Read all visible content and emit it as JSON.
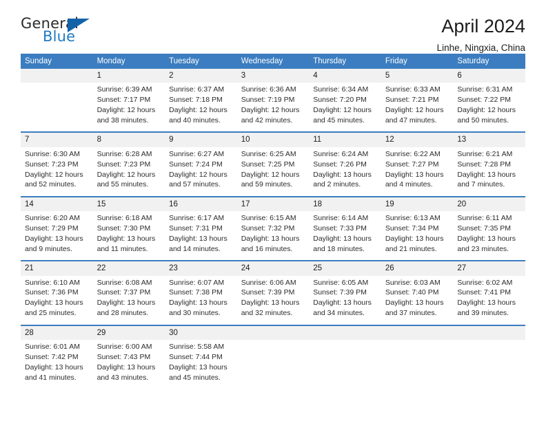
{
  "logo": {
    "word_general": "General",
    "word_blue": "Blue",
    "flag_icon": "blue-triangle-flag-icon"
  },
  "header": {
    "title": "April 2024",
    "location": "Linhe, Ningxia, China"
  },
  "calendar": {
    "columns": [
      "Sunday",
      "Monday",
      "Tuesday",
      "Wednesday",
      "Thursday",
      "Friday",
      "Saturday"
    ],
    "header_bg": "#3b7dc0",
    "daynum_bg": "#f1f1f1",
    "weeks": [
      [
        {
          "day": "",
          "sunrise": "",
          "sunset": "",
          "daylight_1": "",
          "daylight_2": ""
        },
        {
          "day": "1",
          "sunrise": "Sunrise: 6:39 AM",
          "sunset": "Sunset: 7:17 PM",
          "daylight_1": "Daylight: 12 hours",
          "daylight_2": "and 38 minutes."
        },
        {
          "day": "2",
          "sunrise": "Sunrise: 6:37 AM",
          "sunset": "Sunset: 7:18 PM",
          "daylight_1": "Daylight: 12 hours",
          "daylight_2": "and 40 minutes."
        },
        {
          "day": "3",
          "sunrise": "Sunrise: 6:36 AM",
          "sunset": "Sunset: 7:19 PM",
          "daylight_1": "Daylight: 12 hours",
          "daylight_2": "and 42 minutes."
        },
        {
          "day": "4",
          "sunrise": "Sunrise: 6:34 AM",
          "sunset": "Sunset: 7:20 PM",
          "daylight_1": "Daylight: 12 hours",
          "daylight_2": "and 45 minutes."
        },
        {
          "day": "5",
          "sunrise": "Sunrise: 6:33 AM",
          "sunset": "Sunset: 7:21 PM",
          "daylight_1": "Daylight: 12 hours",
          "daylight_2": "and 47 minutes."
        },
        {
          "day": "6",
          "sunrise": "Sunrise: 6:31 AM",
          "sunset": "Sunset: 7:22 PM",
          "daylight_1": "Daylight: 12 hours",
          "daylight_2": "and 50 minutes."
        }
      ],
      [
        {
          "day": "7",
          "sunrise": "Sunrise: 6:30 AM",
          "sunset": "Sunset: 7:23 PM",
          "daylight_1": "Daylight: 12 hours",
          "daylight_2": "and 52 minutes."
        },
        {
          "day": "8",
          "sunrise": "Sunrise: 6:28 AM",
          "sunset": "Sunset: 7:23 PM",
          "daylight_1": "Daylight: 12 hours",
          "daylight_2": "and 55 minutes."
        },
        {
          "day": "9",
          "sunrise": "Sunrise: 6:27 AM",
          "sunset": "Sunset: 7:24 PM",
          "daylight_1": "Daylight: 12 hours",
          "daylight_2": "and 57 minutes."
        },
        {
          "day": "10",
          "sunrise": "Sunrise: 6:25 AM",
          "sunset": "Sunset: 7:25 PM",
          "daylight_1": "Daylight: 12 hours",
          "daylight_2": "and 59 minutes."
        },
        {
          "day": "11",
          "sunrise": "Sunrise: 6:24 AM",
          "sunset": "Sunset: 7:26 PM",
          "daylight_1": "Daylight: 13 hours",
          "daylight_2": "and 2 minutes."
        },
        {
          "day": "12",
          "sunrise": "Sunrise: 6:22 AM",
          "sunset": "Sunset: 7:27 PM",
          "daylight_1": "Daylight: 13 hours",
          "daylight_2": "and 4 minutes."
        },
        {
          "day": "13",
          "sunrise": "Sunrise: 6:21 AM",
          "sunset": "Sunset: 7:28 PM",
          "daylight_1": "Daylight: 13 hours",
          "daylight_2": "and 7 minutes."
        }
      ],
      [
        {
          "day": "14",
          "sunrise": "Sunrise: 6:20 AM",
          "sunset": "Sunset: 7:29 PM",
          "daylight_1": "Daylight: 13 hours",
          "daylight_2": "and 9 minutes."
        },
        {
          "day": "15",
          "sunrise": "Sunrise: 6:18 AM",
          "sunset": "Sunset: 7:30 PM",
          "daylight_1": "Daylight: 13 hours",
          "daylight_2": "and 11 minutes."
        },
        {
          "day": "16",
          "sunrise": "Sunrise: 6:17 AM",
          "sunset": "Sunset: 7:31 PM",
          "daylight_1": "Daylight: 13 hours",
          "daylight_2": "and 14 minutes."
        },
        {
          "day": "17",
          "sunrise": "Sunrise: 6:15 AM",
          "sunset": "Sunset: 7:32 PM",
          "daylight_1": "Daylight: 13 hours",
          "daylight_2": "and 16 minutes."
        },
        {
          "day": "18",
          "sunrise": "Sunrise: 6:14 AM",
          "sunset": "Sunset: 7:33 PM",
          "daylight_1": "Daylight: 13 hours",
          "daylight_2": "and 18 minutes."
        },
        {
          "day": "19",
          "sunrise": "Sunrise: 6:13 AM",
          "sunset": "Sunset: 7:34 PM",
          "daylight_1": "Daylight: 13 hours",
          "daylight_2": "and 21 minutes."
        },
        {
          "day": "20",
          "sunrise": "Sunrise: 6:11 AM",
          "sunset": "Sunset: 7:35 PM",
          "daylight_1": "Daylight: 13 hours",
          "daylight_2": "and 23 minutes."
        }
      ],
      [
        {
          "day": "21",
          "sunrise": "Sunrise: 6:10 AM",
          "sunset": "Sunset: 7:36 PM",
          "daylight_1": "Daylight: 13 hours",
          "daylight_2": "and 25 minutes."
        },
        {
          "day": "22",
          "sunrise": "Sunrise: 6:08 AM",
          "sunset": "Sunset: 7:37 PM",
          "daylight_1": "Daylight: 13 hours",
          "daylight_2": "and 28 minutes."
        },
        {
          "day": "23",
          "sunrise": "Sunrise: 6:07 AM",
          "sunset": "Sunset: 7:38 PM",
          "daylight_1": "Daylight: 13 hours",
          "daylight_2": "and 30 minutes."
        },
        {
          "day": "24",
          "sunrise": "Sunrise: 6:06 AM",
          "sunset": "Sunset: 7:39 PM",
          "daylight_1": "Daylight: 13 hours",
          "daylight_2": "and 32 minutes."
        },
        {
          "day": "25",
          "sunrise": "Sunrise: 6:05 AM",
          "sunset": "Sunset: 7:39 PM",
          "daylight_1": "Daylight: 13 hours",
          "daylight_2": "and 34 minutes."
        },
        {
          "day": "26",
          "sunrise": "Sunrise: 6:03 AM",
          "sunset": "Sunset: 7:40 PM",
          "daylight_1": "Daylight: 13 hours",
          "daylight_2": "and 37 minutes."
        },
        {
          "day": "27",
          "sunrise": "Sunrise: 6:02 AM",
          "sunset": "Sunset: 7:41 PM",
          "daylight_1": "Daylight: 13 hours",
          "daylight_2": "and 39 minutes."
        }
      ],
      [
        {
          "day": "28",
          "sunrise": "Sunrise: 6:01 AM",
          "sunset": "Sunset: 7:42 PM",
          "daylight_1": "Daylight: 13 hours",
          "daylight_2": "and 41 minutes."
        },
        {
          "day": "29",
          "sunrise": "Sunrise: 6:00 AM",
          "sunset": "Sunset: 7:43 PM",
          "daylight_1": "Daylight: 13 hours",
          "daylight_2": "and 43 minutes."
        },
        {
          "day": "30",
          "sunrise": "Sunrise: 5:58 AM",
          "sunset": "Sunset: 7:44 PM",
          "daylight_1": "Daylight: 13 hours",
          "daylight_2": "and 45 minutes."
        },
        {
          "day": "",
          "sunrise": "",
          "sunset": "",
          "daylight_1": "",
          "daylight_2": ""
        },
        {
          "day": "",
          "sunrise": "",
          "sunset": "",
          "daylight_1": "",
          "daylight_2": ""
        },
        {
          "day": "",
          "sunrise": "",
          "sunset": "",
          "daylight_1": "",
          "daylight_2": ""
        },
        {
          "day": "",
          "sunrise": "",
          "sunset": "",
          "daylight_1": "",
          "daylight_2": ""
        }
      ]
    ]
  }
}
